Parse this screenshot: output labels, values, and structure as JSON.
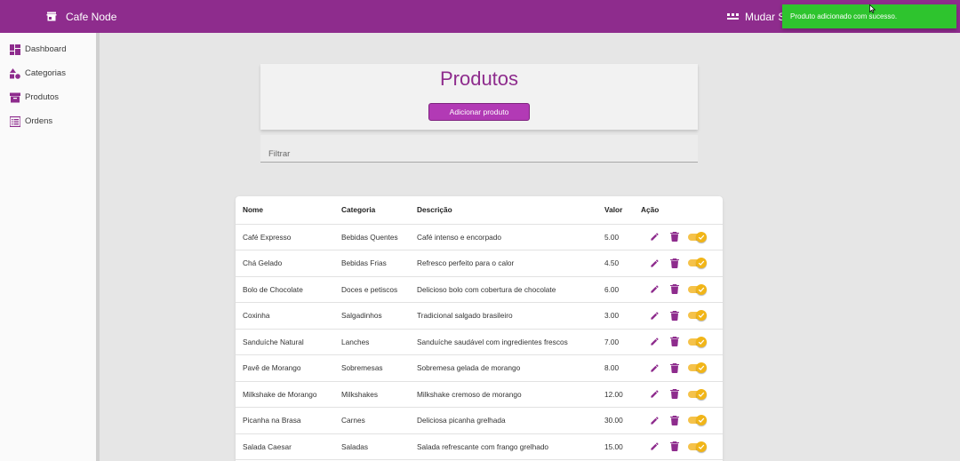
{
  "topbar": {
    "brand_name": "Cafe Node",
    "brand_icon": "store-icon",
    "right_label": "Mudar Se",
    "right_icon": "dots-icon"
  },
  "toast": {
    "message": "Produto adicionado com sucesso."
  },
  "sidebar": {
    "items": [
      {
        "label": "Dashboard",
        "icon": "dashboard-icon"
      },
      {
        "label": "Categorias",
        "icon": "category-icon"
      },
      {
        "label": "Produtos",
        "icon": "inventory-icon"
      },
      {
        "label": "Ordens",
        "icon": "list-icon"
      }
    ]
  },
  "main": {
    "title": "Produtos",
    "add_button_label": "Adicionar produto",
    "filter_placeholder": "Filtrar"
  },
  "table": {
    "headers": [
      "Nome",
      "Categoria",
      "Descrição",
      "Valor",
      "Ação"
    ],
    "rows": [
      [
        "Café Expresso",
        "Bebidas Quentes",
        "Café intenso e encorpado",
        "5.00"
      ],
      [
        "Chá Gelado",
        "Bebidas Frias",
        "Refresco perfeito para o calor",
        "4.50"
      ],
      [
        "Bolo de Chocolate",
        "Doces e petiscos",
        "Delicioso bolo com cobertura de chocolate",
        "6.00"
      ],
      [
        "Coxinha",
        "Salgadinhos",
        "Tradicional salgado brasileiro",
        "3.00"
      ],
      [
        "Sanduíche Natural",
        "Lanches",
        "Sanduíche saudável com ingredientes frescos",
        "7.00"
      ],
      [
        "Pavê de Morango",
        "Sobremesas",
        "Sobremesa gelada de morango",
        "8.00"
      ],
      [
        "Milkshake de Morango",
        "Milkshakes",
        "Milkshake cremoso de morango",
        "12.00"
      ],
      [
        "Picanha na Brasa",
        "Carnes",
        "Deliciosa picanha grelhada",
        "30.00"
      ],
      [
        "Salada Caesar",
        "Saladas",
        "Salada refrescante com frango grelhado",
        "15.00"
      ]
    ]
  },
  "colors": {
    "primary": "#8e2c8d",
    "button": "#b23ab5",
    "toast": "#2ec42e",
    "toggle": "#f1b518"
  }
}
